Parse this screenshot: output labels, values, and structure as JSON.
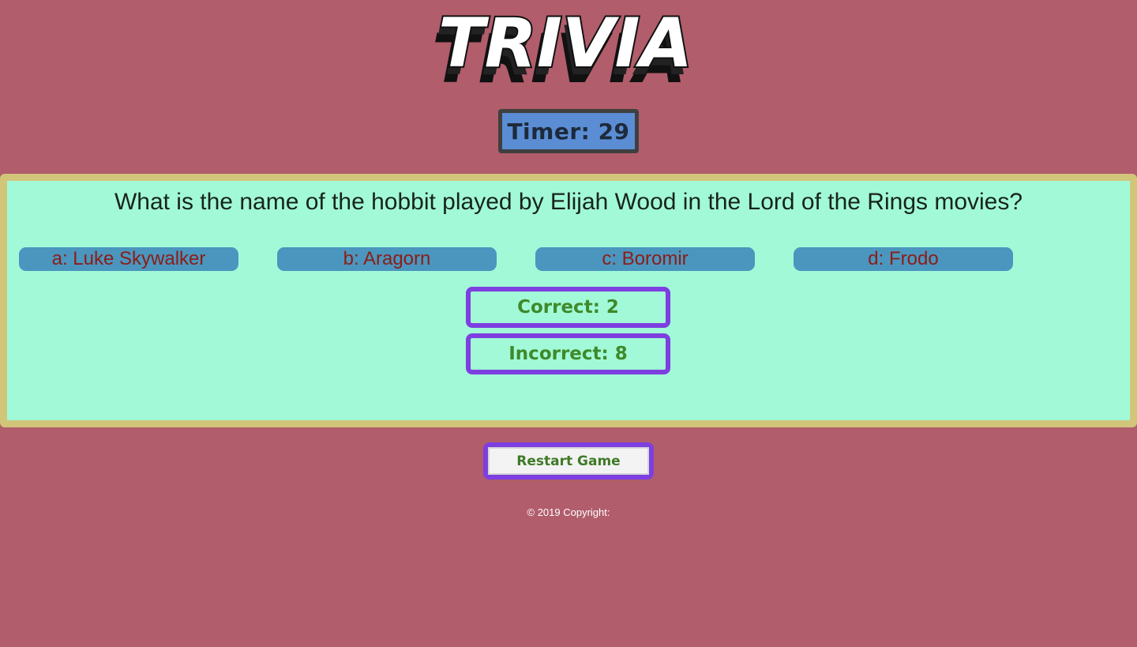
{
  "title": "TRIVIA",
  "timer": {
    "label": "Timer: 29"
  },
  "question": "What is the name of the hobbit played by Elijah Wood in the Lord of the Rings movies?",
  "answers": [
    {
      "label": "a: Luke Skywalker"
    },
    {
      "label": "b: Aragorn"
    },
    {
      "label": "c: Boromir"
    },
    {
      "label": "d: Frodo"
    }
  ],
  "score": {
    "correct": "Correct: 2",
    "incorrect": "Incorrect: 8"
  },
  "restart_label": "Restart Game",
  "footer": "© 2019 Copyright:",
  "colors": {
    "background": "#b15d6b",
    "panel": "#a2f9d8",
    "panel_border": "#d1c57a",
    "timer": "#5b8dd4",
    "answer_button": "#4a96bf",
    "score_border": "#7d3fe0"
  }
}
